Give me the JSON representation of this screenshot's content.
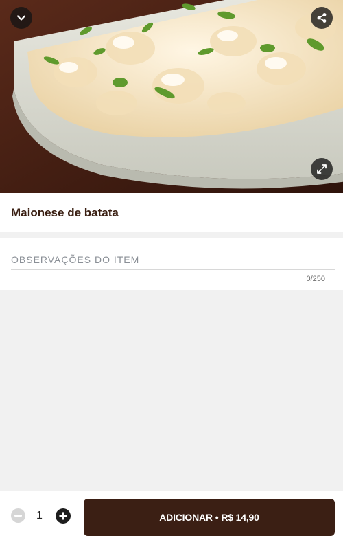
{
  "item": {
    "name": "Maionese de batata",
    "image_alt": "Maionese de batata"
  },
  "hero_icons": {
    "back": "chevron-down-icon",
    "share": "share-icon",
    "expand": "expand-icon"
  },
  "observations": {
    "label": "OBSERVAÇÕES DO ITEM",
    "value": "",
    "counter": "0/250"
  },
  "order": {
    "quantity": "1",
    "add_label": "ADICIONAR",
    "separator": "•",
    "price": "R$ 14,90"
  },
  "colors": {
    "primary": "#3b1f14",
    "background": "#f1f1f1"
  }
}
